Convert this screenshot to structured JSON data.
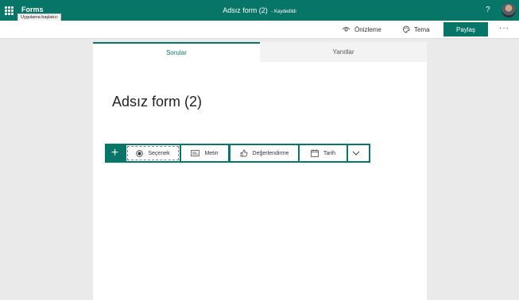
{
  "app": {
    "name": "Forms",
    "launcher_tooltip": "Uygulama başlatıcı",
    "document_title": "Adsız form (2)",
    "save_status": "- Kaydedildi",
    "help": "?"
  },
  "toolbar": {
    "preview_label": "Önizleme",
    "theme_label": "Tema",
    "share_label": "Paylaş",
    "more_label": "···"
  },
  "tabs": [
    {
      "label": "Sorular",
      "active": true
    },
    {
      "label": "Yanıtlar",
      "active": false
    }
  ],
  "form": {
    "title": "Adsız form (2)"
  },
  "add_question": {
    "plus": "+",
    "options": [
      {
        "label": "Seçenek",
        "icon": "radio-icon"
      },
      {
        "label": "Metin",
        "icon": "text-icon"
      },
      {
        "label": "Değerlendirme",
        "icon": "thumbs-up-icon"
      },
      {
        "label": "Tarih",
        "icon": "calendar-icon"
      }
    ]
  },
  "colors": {
    "accent": "#077568",
    "background": "#eaeaea"
  }
}
